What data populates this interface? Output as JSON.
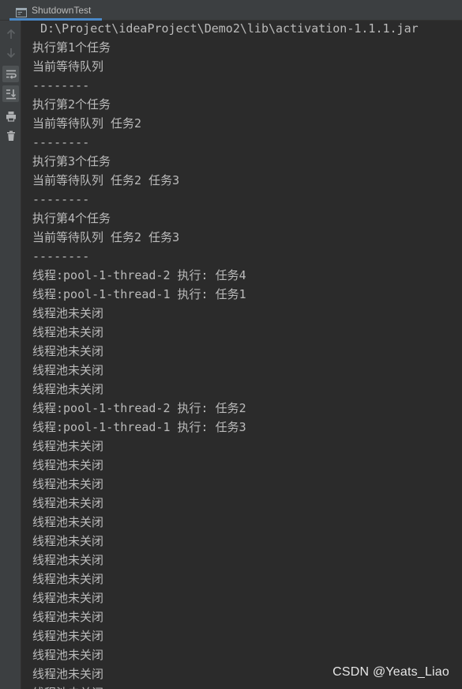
{
  "tab": {
    "title": "ShutdownTest"
  },
  "toolbar": {
    "buttons": [
      "arrow-up-icon",
      "arrow-down-icon",
      "soft-wrap-icon",
      "scroll-to-end-icon",
      "print-icon",
      "trash-icon"
    ]
  },
  "console": {
    "command": "D:\\Project\\ideaProject\\Demo2\\lib\\activation-1.1.1.jar",
    "lines": [
      "执行第1个任务",
      "当前等待队列",
      "--------",
      "执行第2个任务",
      "当前等待队列 任务2",
      "--------",
      "执行第3个任务",
      "当前等待队列 任务2 任务3",
      "--------",
      "执行第4个任务",
      "当前等待队列 任务2 任务3",
      "--------",
      "线程:pool-1-thread-2 执行: 任务4",
      "线程:pool-1-thread-1 执行: 任务1",
      "线程池未关闭",
      "线程池未关闭",
      "线程池未关闭",
      "线程池未关闭",
      "线程池未关闭",
      "线程:pool-1-thread-2 执行: 任务2",
      "线程:pool-1-thread-1 执行: 任务3",
      "线程池未关闭",
      "线程池未关闭",
      "线程池未关闭",
      "线程池未关闭",
      "线程池未关闭",
      "线程池未关闭",
      "线程池未关闭",
      "线程池未关闭",
      "线程池未关闭",
      "线程池未关闭",
      "线程池未关闭",
      "线程池未关闭",
      "线程池未关闭",
      "线程池未关闭"
    ]
  },
  "watermark": "CSDN @Yeats_Liao"
}
